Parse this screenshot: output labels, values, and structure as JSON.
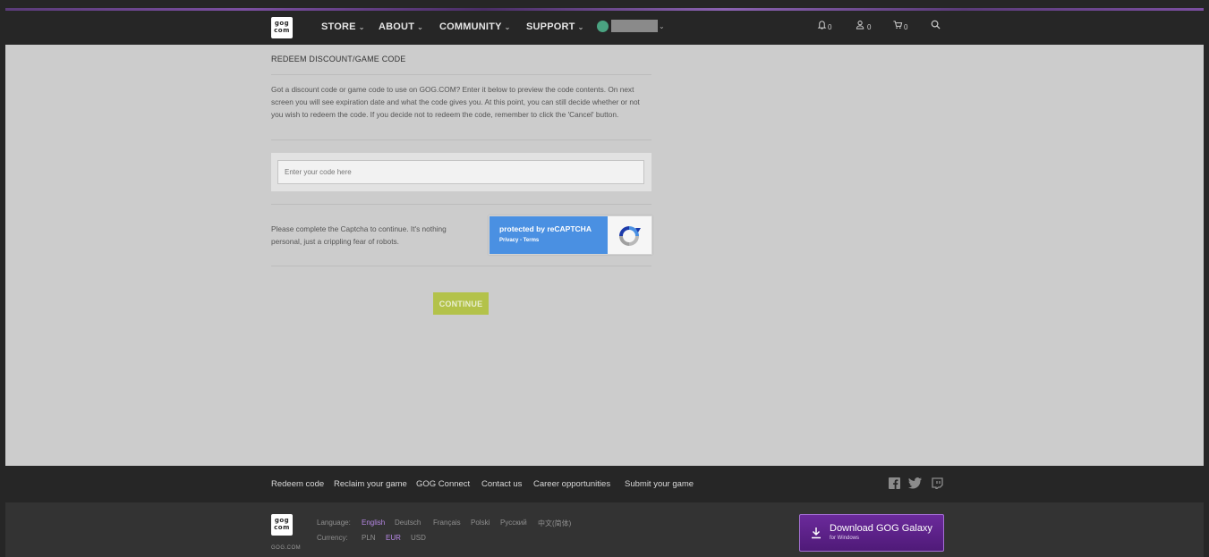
{
  "header": {
    "logo_top": "gog",
    "logo_bottom": "com",
    "nav": [
      {
        "label": "STORE"
      },
      {
        "label": "ABOUT"
      },
      {
        "label": "COMMUNITY"
      },
      {
        "label": "SUPPORT"
      }
    ],
    "counters": {
      "notifications": "0",
      "friends": "0",
      "cart": "0"
    }
  },
  "redeem": {
    "title": "REDEEM DISCOUNT/GAME CODE",
    "description": "Got a discount code or game code to use on GOG.COM? Enter it below to preview the code contents. On next screen you will see expiration date and what the code gives you. At this point, you can still decide whether or not you wish to redeem the code. If you decide not to redeem the code, remember to click the 'Cancel' button.",
    "code_placeholder": "Enter your code here",
    "captcha_text": "Please complete the Captcha to continue. It's nothing personal, just a crippling fear of robots.",
    "recaptcha_title": "protected by reCAPTCHA",
    "recaptcha_links": "Privacy - Terms",
    "continue_label": "CONTINUE"
  },
  "footer": {
    "links": [
      "Redeem code",
      "Reclaim your game",
      "GOG Connect",
      "Contact us",
      "Career opportunities",
      "Submit your game"
    ],
    "gogcom": "GOG.COM",
    "language_label": "Language:",
    "languages": [
      "English",
      "Deutsch",
      "Français",
      "Polski",
      "Русский",
      "中文(简体)"
    ],
    "active_language": "English",
    "currency_label": "Currency:",
    "currencies": [
      "PLN",
      "EUR",
      "USD"
    ],
    "active_currency": "EUR",
    "galaxy_title": "Download GOG Galaxy",
    "galaxy_sub": "for Windows"
  },
  "colors": {
    "accent_purple": "#b788e6",
    "continue_green": "#b3c24a",
    "recaptcha_blue": "#4a90e2"
  },
  "icons": [
    "bell-icon",
    "friends-icon",
    "cart-icon",
    "search-icon",
    "facebook-icon",
    "twitter-icon",
    "twitch-icon",
    "download-icon"
  ]
}
